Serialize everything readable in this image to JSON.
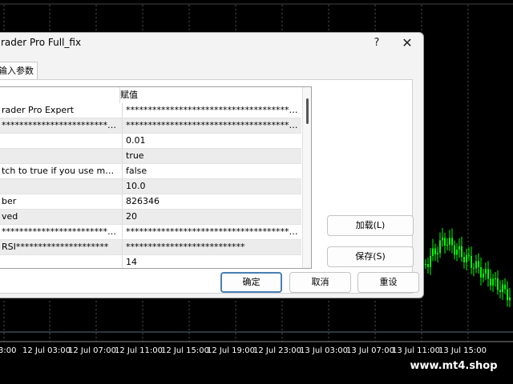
{
  "colors": {
    "chart_background": "#000000",
    "candles": "#00ff00",
    "dialog_background": "#f3f3f3",
    "default_button_border": "#4a7fb5"
  },
  "chart": {
    "time_labels": [
      "12 Jul 03:00",
      "12 Jul 07:00",
      "12 Jul 11:00",
      "12 Jul 15:00",
      "12 Jul 19:00",
      "12 Jul 23:00",
      "13 Jul 03:00",
      "13 Jul 07:00",
      "13 Jul 11:00",
      "13 Jul 15:00"
    ],
    "first_label_fragment": "3:00"
  },
  "watermark": "www.mt4.shop",
  "dialog": {
    "title": "rader Pro Full_fix",
    "help_icon": "question-mark-icon",
    "close_icon": "close-icon",
    "tab_label": "输入参数",
    "grid": {
      "header_name": "",
      "header_value": "赋值",
      "rows": [
        {
          "name": "rader Pro Expert",
          "value": "**************************************************..."
        },
        {
          "name": "************************************...",
          "value": "**************************************************..."
        },
        {
          "name": "",
          "value": "0.01"
        },
        {
          "name": "",
          "value": "true"
        },
        {
          "name": "tch to true if you use mor...",
          "value": "false"
        },
        {
          "name": "",
          "value": "10.0"
        },
        {
          "name": "ber",
          "value": "826346"
        },
        {
          "name": "ved",
          "value": "20"
        },
        {
          "name": "************************************...",
          "value": "**************************************************..."
        },
        {
          "name": "RSI*********************",
          "value": "***************************"
        },
        {
          "name": "",
          "value": "14"
        }
      ]
    },
    "buttons": {
      "load": "加载(L)",
      "save": "保存(S)",
      "ok": "确定",
      "cancel": "取消",
      "reset": "重设"
    }
  }
}
